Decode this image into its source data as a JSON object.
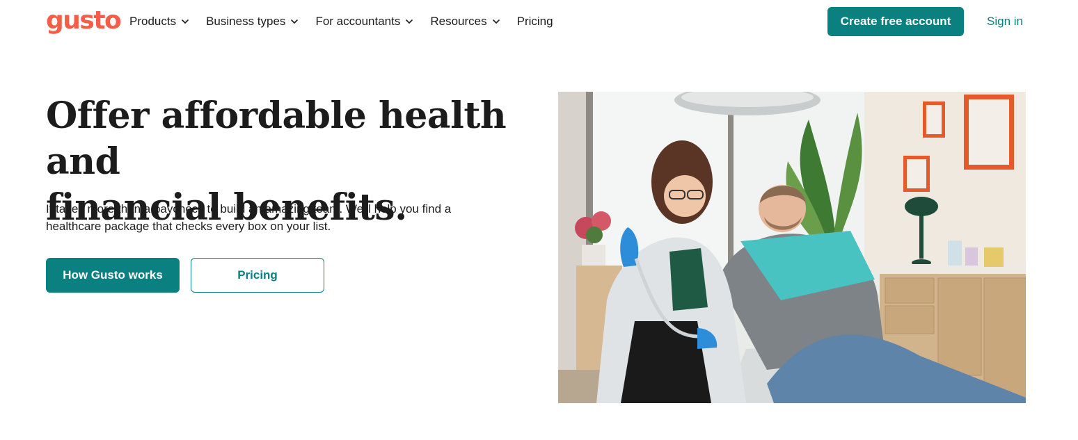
{
  "header": {
    "logo": "gusto",
    "nav": [
      {
        "label": "Products",
        "has_dropdown": true
      },
      {
        "label": "Business types",
        "has_dropdown": true
      },
      {
        "label": "For accountants",
        "has_dropdown": true
      },
      {
        "label": "Resources",
        "has_dropdown": true
      },
      {
        "label": "Pricing",
        "has_dropdown": false
      }
    ],
    "cta": "Create free account",
    "signin": "Sign in"
  },
  "hero": {
    "title_line1": "Offer affordable health and",
    "title_line2": "financial benefits.",
    "subtitle_line1": "It takes more than a paycheck to build an amazing team. We'll help you find a",
    "subtitle_line2": "healthcare package that checks every box on your list.",
    "primary_button": "How Gusto works",
    "secondary_button": "Pricing"
  },
  "colors": {
    "brand": "#f45d48",
    "accent": "#0a8080",
    "text": "#1c1c1c"
  },
  "icons": {
    "dropdown": "chevron-down-icon"
  }
}
